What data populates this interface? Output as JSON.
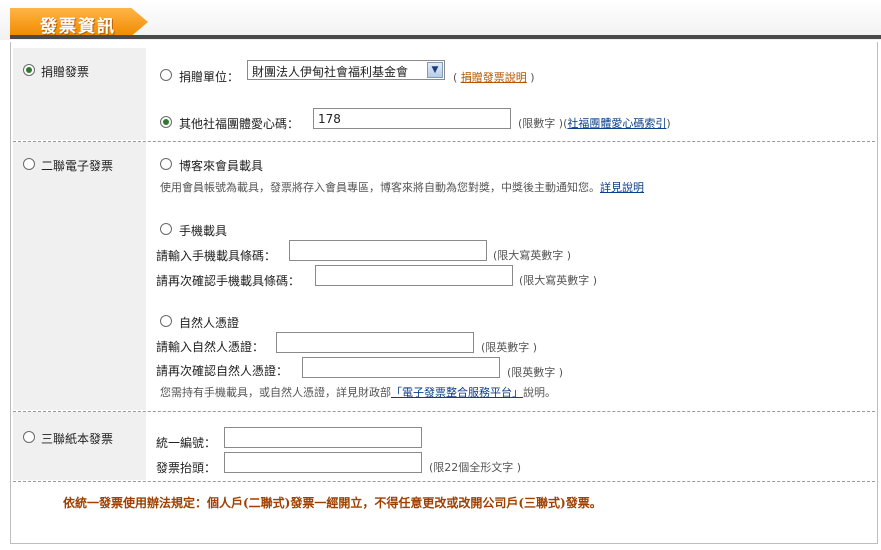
{
  "header": {
    "title": "發票資訊"
  },
  "donate": {
    "option_label": "捐贈發票",
    "unit_label": "捐贈單位：",
    "unit_selected": "財團法人伊甸社會福利基金會",
    "unit_help": "捐贈發票說明",
    "other_label": "其他社福團體愛心碼：",
    "other_value": "178",
    "other_hint_left": "(限數字 )(",
    "other_link": "社福團體愛心碼索引",
    "other_hint_right": ")"
  },
  "e_invoice": {
    "option_label": "二聯電子發票",
    "member": {
      "label": "博客來會員載具",
      "desc": "使用會員帳號為載具，發票將存入會員專區，博客來將自動為您對獎，中獎後主動通知您。",
      "link": "詳見說明"
    },
    "mobile": {
      "label": "手機載具",
      "input_label": "請輸入手機載具條碼：",
      "input_hint": "(限大寫英數字 )",
      "confirm_label": "請再次確認手機載具條碼：",
      "confirm_hint": "(限大寫英數字 )"
    },
    "citizen": {
      "label": "自然人憑證",
      "input_label": "請輸入自然人憑證：",
      "input_hint": "(限英數字 )",
      "confirm_label": "請再次確認自然人憑證：",
      "confirm_hint": "(限英數字 )",
      "note_prefix": "您需持有手機載具，或自然人憑證，詳見財政部",
      "note_link": "「電子發票整合服務平台」",
      "note_suffix": "說明。"
    }
  },
  "paper": {
    "option_label": "三聯紙本發票",
    "tax_id_label": "統一編號：",
    "title_label": "發票抬頭：",
    "title_hint": "(限22個全形文字 )"
  },
  "rule_text": "依統一發票使用辦法規定：個人戶(二聯式)發票一經開立，不得任意更改或改開公司戶(三聯式)發票。"
}
